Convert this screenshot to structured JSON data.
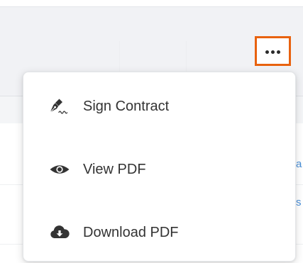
{
  "header": {
    "more_button": {
      "label": "•••",
      "highlight_color": "#e8620f"
    }
  },
  "background": {
    "right_edge_links": [
      "a",
      "s"
    ],
    "link_color": "#4a90d9"
  },
  "actions_menu": {
    "items": [
      {
        "label": "Sign Contract",
        "icon": "pen-signature-icon"
      },
      {
        "label": "View PDF",
        "icon": "eye-icon"
      },
      {
        "label": "Download PDF",
        "icon": "cloud-download-icon"
      }
    ]
  }
}
